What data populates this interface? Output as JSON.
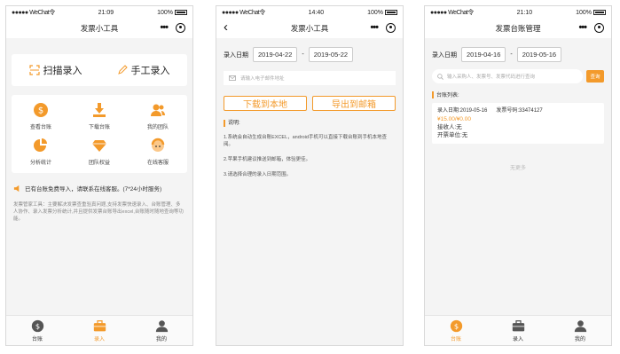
{
  "status": {
    "signal": "●●●●● WeChat令",
    "battery": "100%"
  },
  "screen1": {
    "time": "21:09",
    "title": "发票小工具",
    "scan_label": "扫描录入",
    "manual_label": "手工录入",
    "grid": [
      {
        "label": "查看台账",
        "icon": "dollar-icon"
      },
      {
        "label": "下载台账",
        "icon": "download-icon"
      },
      {
        "label": "我的团队",
        "icon": "team-icon"
      },
      {
        "label": "分析统计",
        "icon": "pie-chart-icon"
      },
      {
        "label": "团队权益",
        "icon": "diamond-icon"
      },
      {
        "label": "在线客服",
        "icon": "service-icon"
      }
    ],
    "notice": "已有台账免费导入，请联系在线客服。(7*24小时服务)",
    "desc": "发票管家工具：主要解决发票查重验真问题,支持发票快速录入、台账管理、多人协作、录入发票分析统计,并且提供发票台账导出excel,台账随时随地查询等功能。",
    "tabs": [
      "台账",
      "录入",
      "我的"
    ]
  },
  "screen2": {
    "time": "14:40",
    "title": "发票小工具",
    "date_label": "录入日期",
    "date_from": "2019-04-22",
    "date_sep": "-",
    "date_to": "2019-05-22",
    "email_placeholder": "请输入电子邮件地址",
    "download_btn": "下载到本地",
    "export_btn": "导出到邮箱",
    "note_title": "说明:",
    "notes": [
      "1.系统会自动生成台账EXCEL，android手机可以直接下载台账到手机本地查阅。",
      "2.苹果手机建议推送到邮箱，体验更佳。",
      "3.请选择合理的录入日期范围。"
    ]
  },
  "screen3": {
    "time": "21:10",
    "title": "发票台账管理",
    "date_label": "录入日期",
    "date_from": "2019-04-16",
    "date_sep": "-",
    "date_to": "2019-05-16",
    "search_placeholder": "输入采购人、发票号、发票代码进行查询",
    "query_btn": "查询",
    "list_title": "台账列表:",
    "card": {
      "entry_date": "录入日期:2019-05-16",
      "invoice_no": "发票号码:33474127",
      "amount": "¥15.00/¥0.00",
      "buyer": "接收人:无",
      "issuer": "开票单位:无"
    },
    "no_more": "无更多",
    "tabs": [
      "台账",
      "录入",
      "我的"
    ]
  },
  "colors": {
    "accent": "#f39a2b"
  }
}
